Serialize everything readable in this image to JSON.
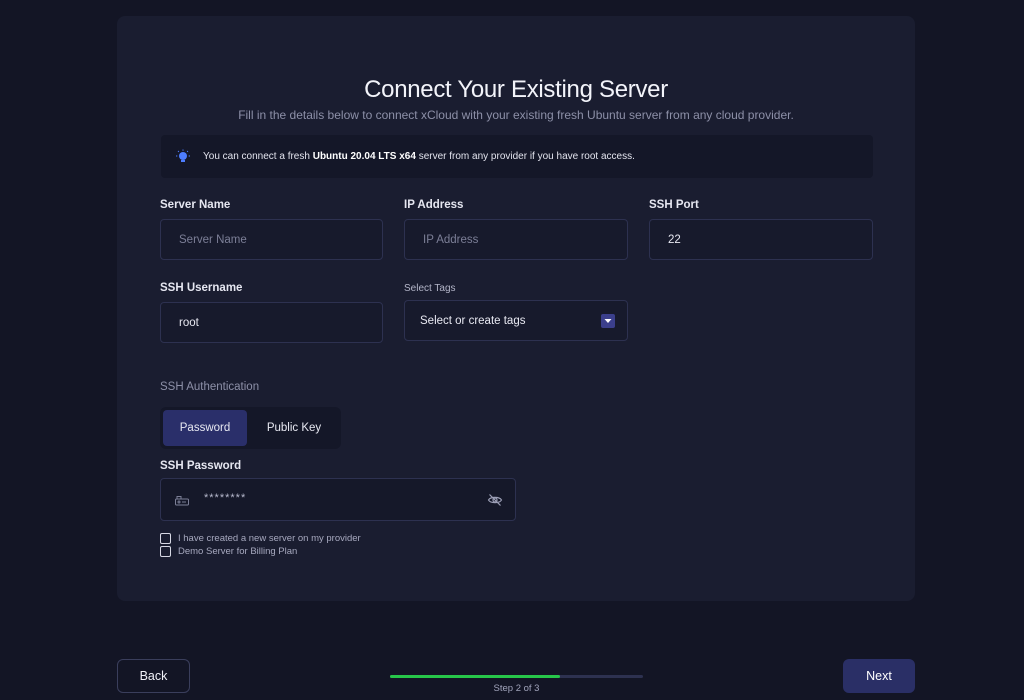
{
  "header": {
    "title": "Connect Your Existing Server",
    "subtitle": "Fill in the details below to connect xCloud with your existing fresh Ubuntu server from any cloud provider."
  },
  "notice": {
    "icon": "lightbulb-icon",
    "text_before": "You can connect a fresh",
    "text_bold": "Ubuntu 20.04 LTS x64",
    "text_after": "server from any provider if you have root access."
  },
  "form": {
    "server_name": {
      "label": "Server Name",
      "placeholder": "Server Name",
      "value": ""
    },
    "ip_address": {
      "label": "IP Address",
      "placeholder": "IP Address",
      "value": ""
    },
    "ssh_port": {
      "label": "SSH Port",
      "value": "22"
    },
    "ssh_username": {
      "label": "SSH Username",
      "value": "root"
    },
    "tags": {
      "label": "Select Tags",
      "placeholder": "Select or create tags"
    },
    "ssh_auth": {
      "label": "SSH Authentication",
      "options": [
        "Password",
        "Public Key"
      ],
      "selected": "Password"
    },
    "ssh_password": {
      "label": "SSH Password",
      "masked_value": "********"
    },
    "checkboxes": [
      {
        "label": "I have created a new server on my provider",
        "checked": false
      },
      {
        "label": "Demo Server for Billing Plan",
        "checked": false
      }
    ]
  },
  "footer": {
    "back_label": "Back",
    "next_label": "Next",
    "step_text": "Step 2 of 3",
    "progress": 0.67
  },
  "colors": {
    "background": "#131525",
    "card": "#1a1d30",
    "accent": "#2a2f6a",
    "progress": "#27c64a"
  }
}
